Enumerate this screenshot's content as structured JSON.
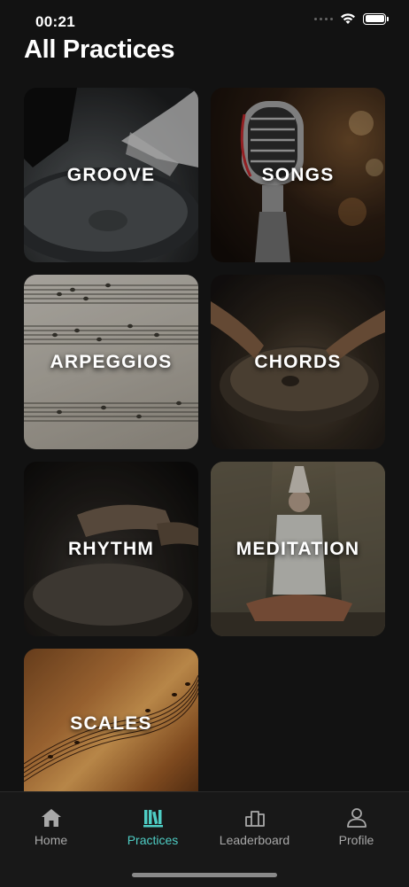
{
  "status_bar": {
    "time": "00:21"
  },
  "header": {
    "title": "All Practices"
  },
  "practices": [
    {
      "label": "GROOVE"
    },
    {
      "label": "SONGS"
    },
    {
      "label": "ARPEGGIOS"
    },
    {
      "label": "CHORDS"
    },
    {
      "label": "RHYTHM"
    },
    {
      "label": "MEDITATION"
    },
    {
      "label": "SCALES"
    }
  ],
  "tab_bar": {
    "items": [
      {
        "label": "Home",
        "icon": "home-icon"
      },
      {
        "label": "Practices",
        "icon": "practices-icon",
        "active": true
      },
      {
        "label": "Leaderboard",
        "icon": "leaderboard-icon"
      },
      {
        "label": "Profile",
        "icon": "profile-icon"
      }
    ],
    "active_color": "#4ecdc4",
    "inactive_color": "#a8a8a8"
  }
}
